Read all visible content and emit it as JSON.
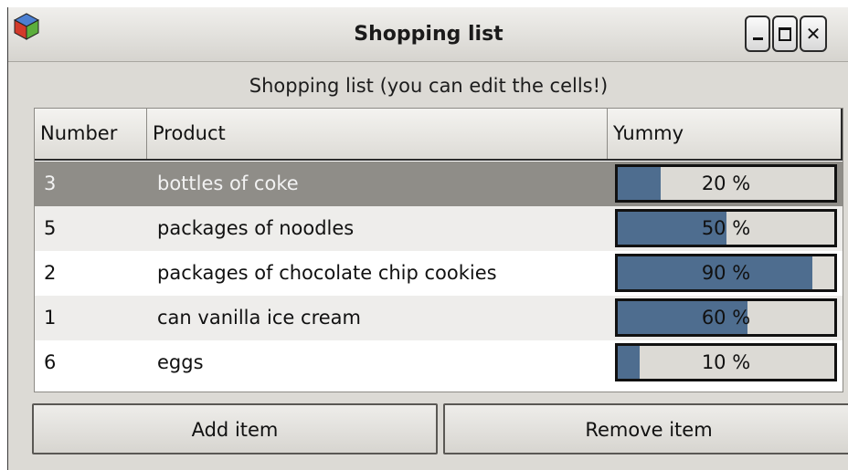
{
  "window": {
    "title": "Shopping list",
    "app_icon": "gtk-cube-icon"
  },
  "caption": "Shopping list (you can edit the cells!)",
  "table": {
    "columns": [
      "Number",
      "Product",
      "Yummy"
    ],
    "rows": [
      {
        "number": "3",
        "product": "bottles of coke",
        "yummy_label": "20 %",
        "yummy": 0.2,
        "selected": true
      },
      {
        "number": "5",
        "product": "packages of noodles",
        "yummy_label": "50 %",
        "yummy": 0.5,
        "selected": false
      },
      {
        "number": "2",
        "product": "packages of chocolate chip cookies",
        "yummy_label": "90 %",
        "yummy": 0.9,
        "selected": false
      },
      {
        "number": "1",
        "product": "can vanilla ice cream",
        "yummy_label": "60 %",
        "yummy": 0.6,
        "selected": false
      },
      {
        "number": "6",
        "product": "eggs",
        "yummy_label": "10 %",
        "yummy": 0.1,
        "selected": false
      }
    ]
  },
  "buttons": {
    "add": "Add item",
    "remove": "Remove item"
  },
  "colors": {
    "progress_fill": "#4e6d8f",
    "selected_row": "#8f8d88",
    "window_bg": "#dcdad5"
  }
}
